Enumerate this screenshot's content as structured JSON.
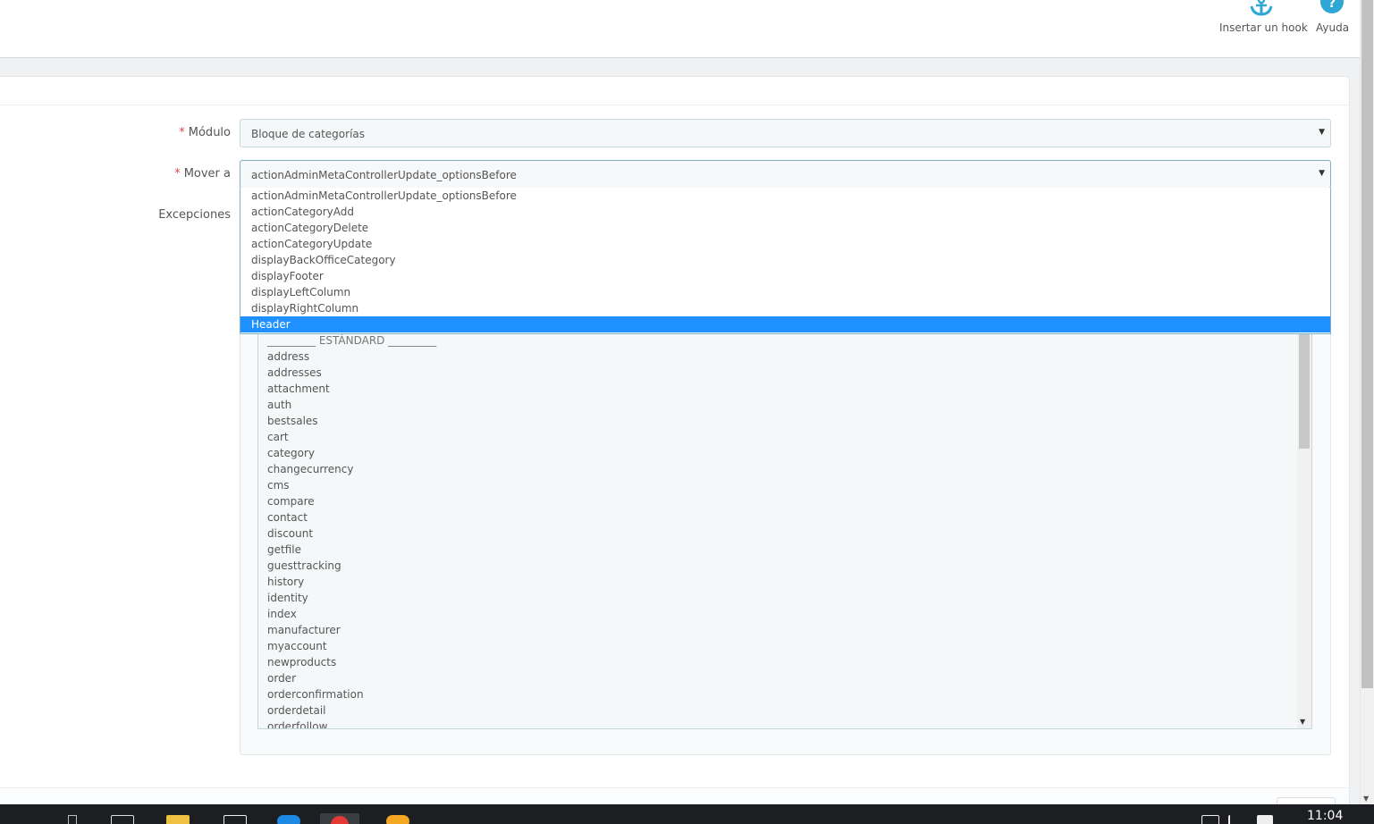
{
  "toolbar": {
    "insert_hook_label": "Insertar un hook",
    "help_label": "Ayuda",
    "icon_color": "#2ea7d5"
  },
  "form": {
    "module_label": "Módulo",
    "module_value": "Bloque de categorías",
    "move_label": "Mover a",
    "move_value": "actionAdminMetaControllerUpdate_optionsBefore",
    "exceptions_label": "Excepciones"
  },
  "hook_options": [
    "actionAdminMetaControllerUpdate_optionsBefore",
    "actionCategoryAdd",
    "actionCategoryDelete",
    "actionCategoryUpdate",
    "displayBackOfficeCategory",
    "displayFooter",
    "displayLeftColumn",
    "displayRightColumn",
    "Header"
  ],
  "highlighted_option": "Header",
  "exception_header": "_________ ESTÁNDARD _________",
  "exception_options": [
    "address",
    "addresses",
    "attachment",
    "auth",
    "bestsales",
    "cart",
    "category",
    "changecurrency",
    "cms",
    "compare",
    "contact",
    "discount",
    "getfile",
    "guesttracking",
    "history",
    "identity",
    "index",
    "manufacturer",
    "myaccount",
    "newproducts",
    "order",
    "orderconfirmation",
    "orderdetail",
    "orderfollow"
  ],
  "taskbar": {
    "clock": "11:04"
  },
  "colors": {
    "selected_bg": "#1e90ff",
    "required": "#e3474c"
  }
}
